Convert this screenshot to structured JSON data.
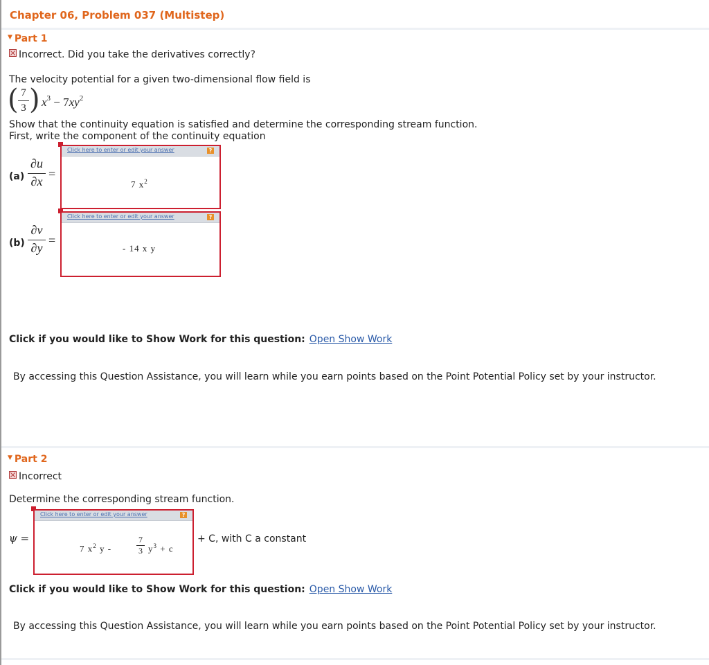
{
  "header": {
    "title": "Chapter 06, Problem 037 (Multistep)"
  },
  "part1": {
    "title": "Part 1",
    "status": "Incorrect. Did you take the derivatives correctly?",
    "intro": "The velocity potential for a given two-dimensional flow field is",
    "formula": {
      "num": "7",
      "den": "3",
      "term1": "x",
      "exp1": "3",
      "minus": "− 7",
      "term2": "xy",
      "exp2": "2"
    },
    "instruction1": "Show that the continuity equation is satisfied and determine the corresponding stream function.",
    "instruction2": "First, write the component of the continuity equation",
    "a": {
      "label": "(a)",
      "num": "∂u",
      "den": "∂x",
      "eq": "=",
      "answer_base": "7 x",
      "answer_exp": "2"
    },
    "b": {
      "label": "(b)",
      "num": "∂v",
      "den": "∂y",
      "eq": "=",
      "answer": "- 14 x y"
    },
    "show_work_prompt": "Click if you would like to Show Work for this question:",
    "show_work_link": "Open Show Work",
    "assist_text": "By accessing this Question Assistance, you will learn while you earn points based on the Point Potential Policy set by your instructor."
  },
  "part2": {
    "title": "Part 2",
    "status": "Incorrect",
    "intro": "Determine the corresponding stream function.",
    "psi": "ψ =",
    "answer": {
      "t1": "7 x",
      "e1": "2",
      "t2": "y -",
      "fn": "7",
      "fd": "3",
      "t3": "y",
      "e3": "3",
      "t4": "+ c"
    },
    "suffix": "+ C, with C a constant",
    "show_work_prompt": "Click if you would like to Show Work for this question:",
    "show_work_link": "Open Show Work",
    "assist_text": "By accessing this Question Assistance, you will learn while you earn points based on the Point Potential Policy set by your instructor."
  },
  "answer_box": {
    "hint": "Click here to enter or edit your answer",
    "help": "?"
  },
  "colors": {
    "accent": "#e0661c",
    "error_border": "#cc1f2f",
    "link": "#2a5aa8"
  }
}
